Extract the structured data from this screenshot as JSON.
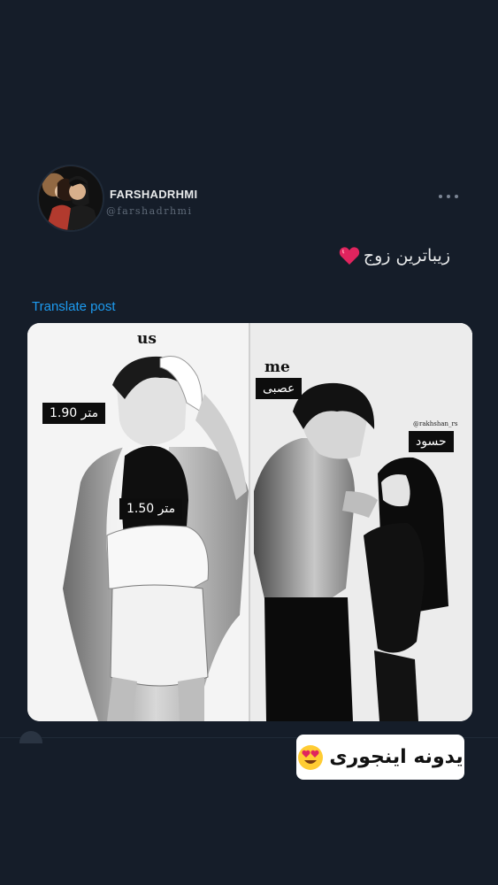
{
  "post": {
    "display_name": "FARSHADRHMI",
    "handle": "@farshadrhmi",
    "text": "زیباترین زوج",
    "translate_label": "Translate post"
  },
  "media": {
    "left_caption": "us",
    "right_caption": "me",
    "labels": {
      "tall_height": "1.90 متر",
      "short_height": "1.50 متر",
      "angry": "عصبی",
      "jealous": "حسود"
    },
    "watermark": "@rakhshan_rs"
  },
  "overlay": {
    "caption": "یدونه اینجوری"
  },
  "icons": {
    "heart": "heart-icon",
    "more": "more-icon",
    "emoji": "heart-eyes-emoji-icon"
  },
  "colors": {
    "background": "#151d29",
    "link": "#1d9bf0",
    "heart": "#e0245e"
  }
}
